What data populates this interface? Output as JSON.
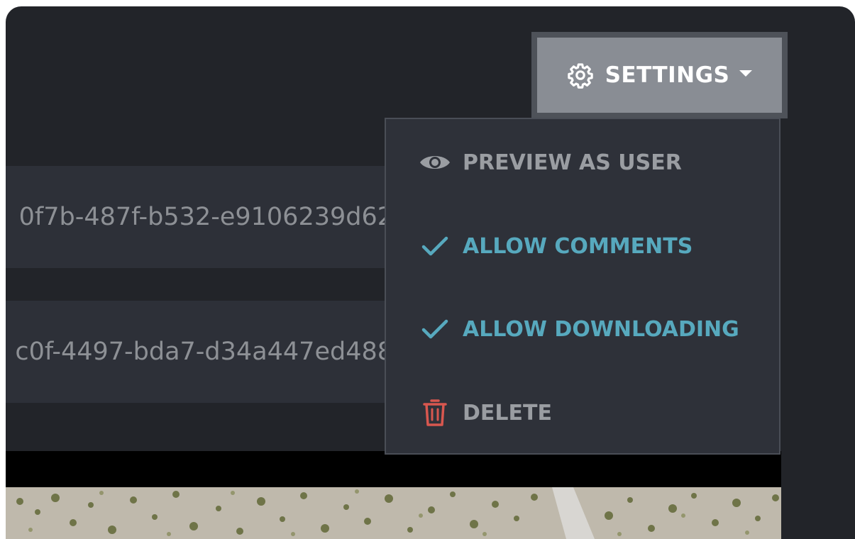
{
  "fields": {
    "share_id_1": "0f7b-487f-b532-e9106239d62",
    "share_id_2": "c0f-4497-bda7-d34a447ed488"
  },
  "settings": {
    "button_label": "SETTINGS",
    "button_icon": "gear-icon",
    "menu": {
      "preview_as_user": {
        "label": "PREVIEW AS USER",
        "icon": "eye-icon"
      },
      "allow_comments": {
        "label": "ALLOW COMMENTS",
        "icon": "checkmark-icon",
        "checked": true
      },
      "allow_downloading": {
        "label": "ALLOW DOWNLOADING",
        "icon": "checkmark-icon",
        "checked": true
      },
      "delete": {
        "label": "DELETE",
        "icon": "trash-icon"
      }
    }
  },
  "colors": {
    "background": "#222429",
    "field_bg": "#2d3038",
    "accent_teal": "#57a9be",
    "danger_red": "#d8574f",
    "button_bg": "#898d94",
    "menu_bg": "#2e3139"
  }
}
